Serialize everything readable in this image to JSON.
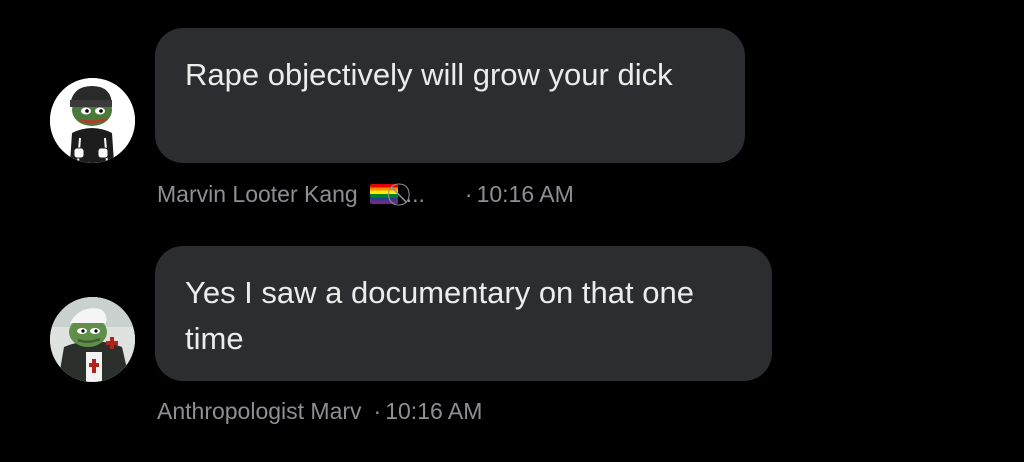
{
  "messages": [
    {
      "text": "Rape objectively will grow your dick",
      "author": "Marvin Looter Kang",
      "flag_emoji": "rainbow-flag",
      "no_entry_symbol": "⃠",
      "ellipsis": "...",
      "dot": "·",
      "time": "10:16 AM",
      "avatar_icon": "pepe-adidas-avatar"
    },
    {
      "text": "Yes I saw a documentary on that one time",
      "author": "Anthropologist Marv",
      "dot": "·",
      "time": "10:16 AM",
      "avatar_icon": "pepe-crusader-avatar"
    }
  ],
  "colors": {
    "background": "#000000",
    "bubble": "#2c2d30",
    "message_text": "#ececec",
    "meta_text": "#8e8f94"
  }
}
